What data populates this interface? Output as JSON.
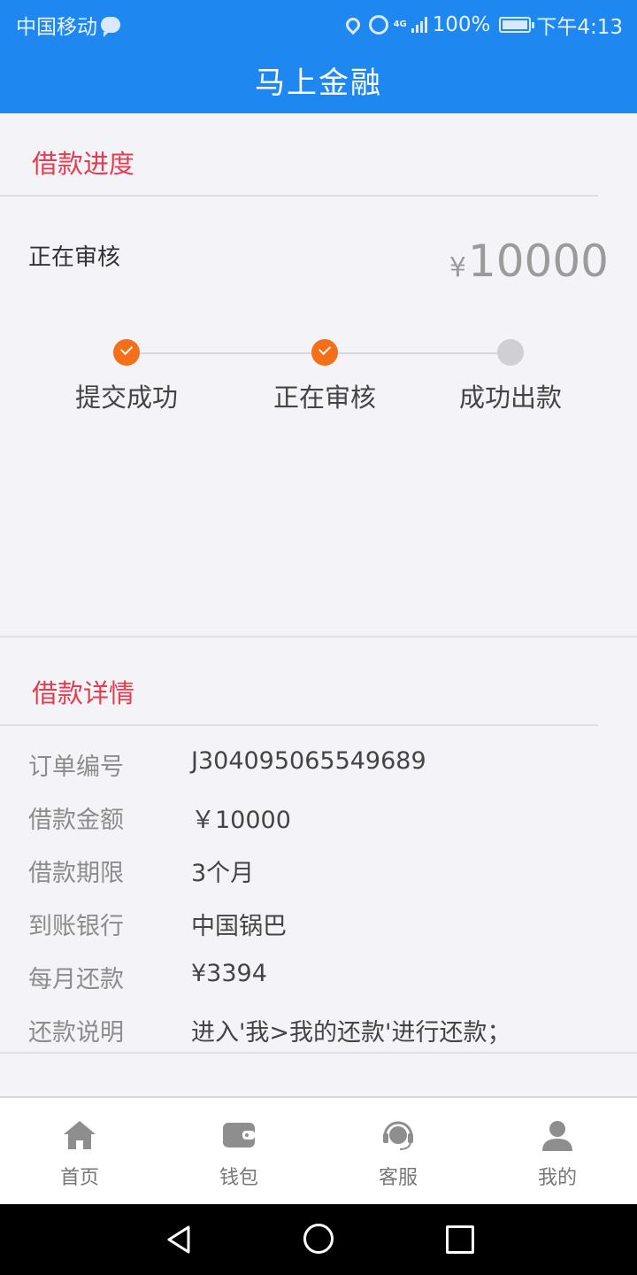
{
  "status_bar": {
    "carrier": "中国移动",
    "network": "4G",
    "battery": "100%",
    "time": "下午4:13"
  },
  "header": {
    "title": "马上金融"
  },
  "progress_section": {
    "title": "借款进度",
    "status": "正在审核",
    "currency_symbol": "¥",
    "amount": "10000",
    "steps": [
      {
        "label": "提交成功",
        "state": "done"
      },
      {
        "label": "正在审核",
        "state": "done"
      },
      {
        "label": "成功出款",
        "state": "pending"
      }
    ]
  },
  "details_section": {
    "title": "借款详情",
    "rows": [
      {
        "key": "订单编号",
        "value": "J304095065549689"
      },
      {
        "key": "借款金额",
        "value": "￥10000"
      },
      {
        "key": "借款期限",
        "value": "3个月"
      },
      {
        "key": "到账银行",
        "value": "中国锅巴"
      },
      {
        "key": "每月还款",
        "value": "¥3394"
      },
      {
        "key": "还款说明",
        "value": "进入'我>我的还款'进行还款；"
      }
    ]
  },
  "tabbar": {
    "items": [
      {
        "label": "首页",
        "icon": "home-icon"
      },
      {
        "label": "钱包",
        "icon": "wallet-icon"
      },
      {
        "label": "客服",
        "icon": "headset-icon"
      },
      {
        "label": "我的",
        "icon": "user-icon"
      }
    ]
  },
  "colors": {
    "primary": "#1e87f0",
    "accent_red": "#e33d4f",
    "step_done": "#f46f19",
    "step_pending": "#cfcfd4"
  }
}
